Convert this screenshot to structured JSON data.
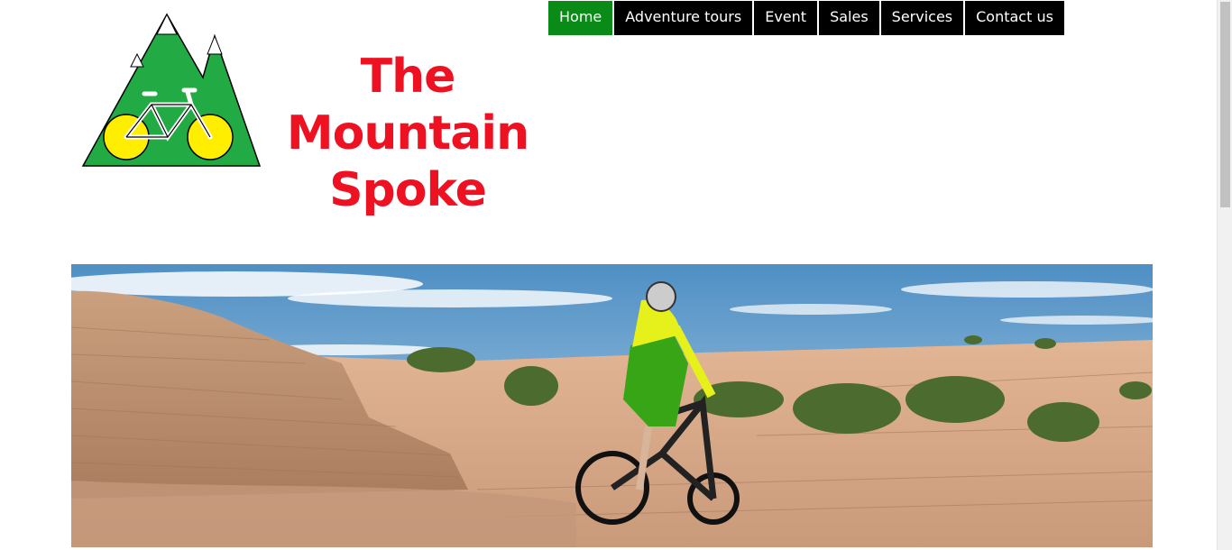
{
  "brand": {
    "line1": "The",
    "line2": "Mountain",
    "line3": "Spoke",
    "color": "#ee1122"
  },
  "logo": {
    "icon": "mountain-bike-logo",
    "colors": {
      "mountain": "#22aa44",
      "wheels": "#ffee00"
    }
  },
  "nav": {
    "items": [
      {
        "label": "Home",
        "active": true
      },
      {
        "label": "Adventure tours"
      },
      {
        "label": "Event"
      },
      {
        "label": "Sales"
      },
      {
        "label": "Services"
      },
      {
        "label": "Contact us"
      }
    ],
    "active_color": "#0a8a16",
    "default_color": "#000000"
  },
  "hero": {
    "subject": "mountain-biker-on-slickrock"
  }
}
